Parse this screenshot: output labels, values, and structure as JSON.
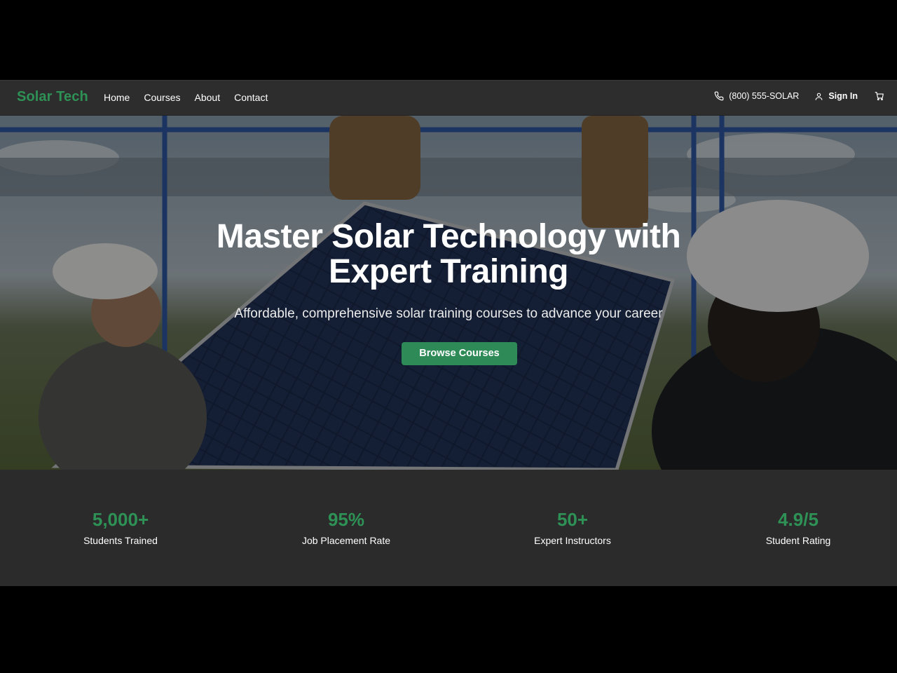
{
  "nav": {
    "brand": "Solar Tech",
    "links": [
      "Home",
      "Courses",
      "About",
      "Contact"
    ],
    "phone": "(800) 555-SOLAR",
    "sign_in": "Sign In",
    "icons": {
      "phone": "phone-icon",
      "user": "user-icon",
      "cart": "cart-icon"
    }
  },
  "hero": {
    "title": "Master Solar Technology with Expert Training",
    "subtitle": "Affordable, comprehensive solar training courses to advance your career",
    "cta": "Browse Courses"
  },
  "stats": [
    {
      "value": "5,000+",
      "label": "Students Trained"
    },
    {
      "value": "95%",
      "label": "Job Placement Rate"
    },
    {
      "value": "50+",
      "label": "Expert Instructors"
    },
    {
      "value": "4.9/5",
      "label": "Student Rating"
    }
  ],
  "colors": {
    "brand_green": "#2e9155",
    "button_green": "#2e8b57",
    "nav_bg": "#2d2d2d",
    "stats_bg": "#2b2b2b",
    "page_bg": "#000000"
  }
}
